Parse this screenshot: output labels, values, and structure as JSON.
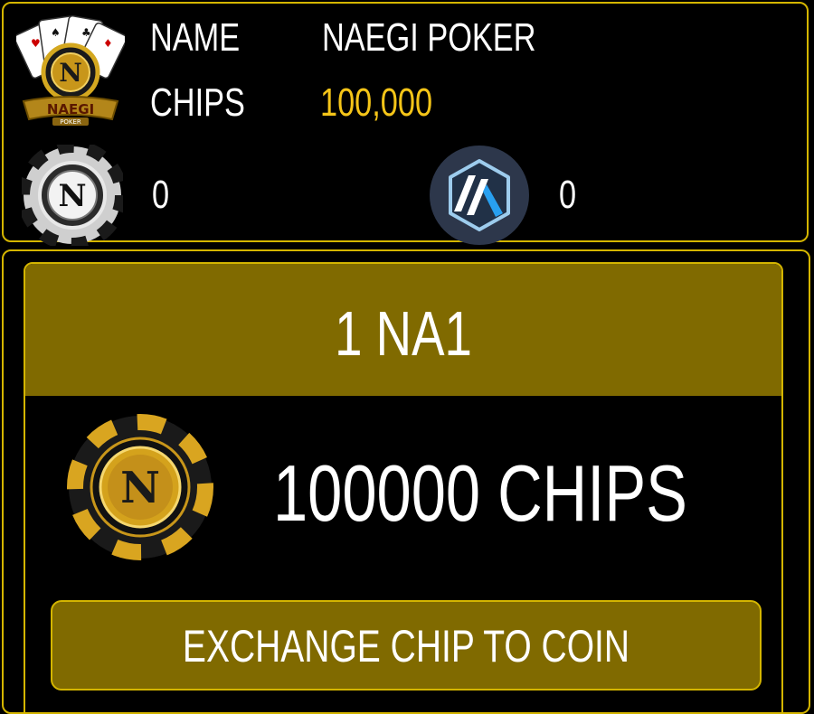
{
  "profile": {
    "logo_icon": "naegi-poker-logo",
    "name_label": "NAME",
    "name_value": "NAEGI POKER",
    "chips_label": "CHIPS",
    "chips_value": "100,000",
    "chips_color": "#f5c518"
  },
  "balances": [
    {
      "icon": "na-chip-coin-icon",
      "value": "0"
    },
    {
      "icon": "arbitrum-coin-icon",
      "value": "0"
    }
  ],
  "offer": {
    "title": "1 NA1",
    "chip_icon": "gold-chip-icon",
    "amount": "100000 CHIPS",
    "button_label": "EXCHANGE CHIP TO COIN"
  },
  "colors": {
    "accent_gold": "#d4b500",
    "panel_gold": "#806a00",
    "background": "#000000"
  }
}
